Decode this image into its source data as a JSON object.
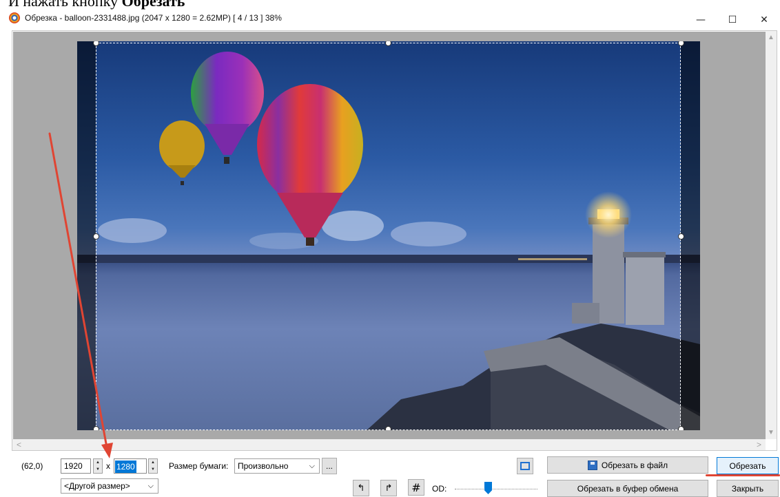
{
  "doc": {
    "heading_normal": "И нажать кнопку ",
    "heading_bold": "Обрезать"
  },
  "window": {
    "title": "Обрезка  -  balloon-2331488.jpg  (2047 x 1280 = 2.62MP)  [ 4 / 13 ]  38%",
    "minimize_glyph": "—",
    "maximize_glyph": "☐",
    "close_glyph": "✕"
  },
  "icons": {
    "app": "app-logo-icon",
    "spin_up": "▲",
    "spin_down": "▼",
    "dropdown": "⌵",
    "rotate_left": "↰",
    "rotate_right": "↱",
    "grid": "#",
    "scroll_up": "▲",
    "scroll_down": "▼",
    "scroll_left": "<",
    "scroll_right": ">"
  },
  "crop": {
    "position": "(62,0)",
    "width": "1920",
    "times": "x",
    "height": "1280",
    "paper_label": "Размер бумаги:",
    "paper_value": "Произвольно",
    "ellipsis": "...",
    "preset": "<Другой размер>",
    "od_label": "OD:",
    "od_level": 0.4
  },
  "buttons": {
    "crop_to_file": "Обрезать в файл",
    "crop": "Обрезать",
    "crop_to_clipboard": "Обрезать в буфер обмена",
    "close": "Закрыть"
  },
  "colors": {
    "annotation": "#e04533",
    "accent": "#0078d7"
  }
}
